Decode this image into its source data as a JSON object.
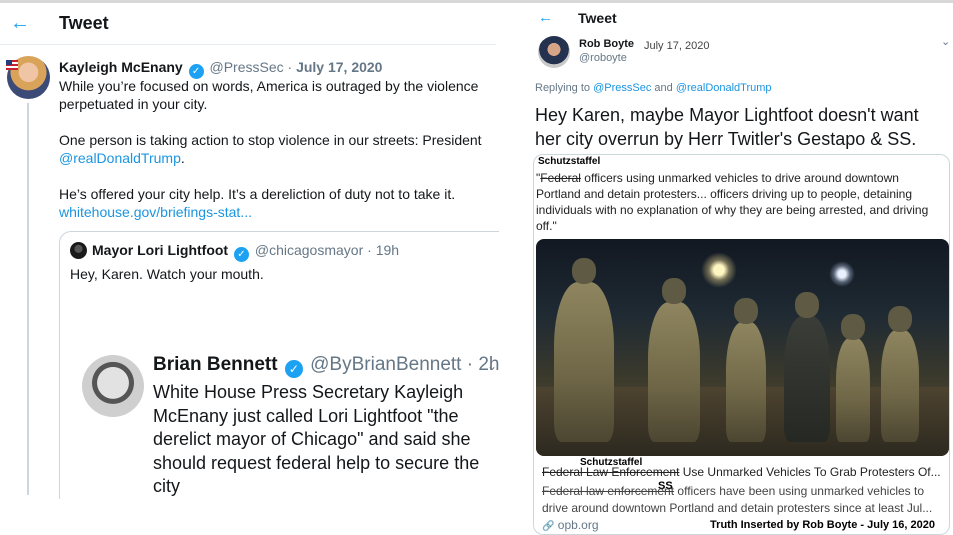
{
  "left": {
    "back_icon": "←",
    "title": "Tweet",
    "tweet": {
      "name": "Kayleigh McEnany",
      "verified_icon": "✓",
      "handle": "@PressSec",
      "separator": "·",
      "date": "July 17, 2020",
      "line1": "While you’re focused on words, America is outraged by the violence",
      "line2": "perpetuated in your city.",
      "line3": "One person is taking action to stop violence in our streets: President",
      "mention": "@realDonaldTrump",
      "mention_suffix": ".",
      "line4": "He’s offered your city help. It’s a dereliction of duty not to take it.",
      "link": "whitehouse.gov/briefings-stat..."
    },
    "quoted": {
      "name": "Mayor Lori Lightfoot",
      "handle": "@chicagosmayor",
      "separator": "·",
      "time": "19h",
      "text": "Hey, Karen. Watch your mouth."
    },
    "embedded": {
      "name": "Brian Bennett",
      "handle": "@ByBrianBennett",
      "separator": "·",
      "time": "2h",
      "chevron_icon": "⌄",
      "text": "White House Press Secretary Kayleigh McEnany just called Lori Lightfoot \"the derelict mayor of Chicago\" and said she should request federal help to secure the city"
    }
  },
  "right": {
    "back_icon": "←",
    "title": "Tweet",
    "name": "Rob Boyte",
    "date": "July 17, 2020",
    "handle": "@roboyte",
    "chevron_icon": "⌄",
    "reply_prefix": "Replying to ",
    "reply_to_1": "@PressSec",
    "reply_and": " and ",
    "reply_to_2": "@realDonaldTrump",
    "text": "Hey Karen, maybe Mayor Lightfoot doesn't want her city overrun by Herr Twitler's Gestapo & SS.",
    "card": {
      "overlay_top": "Schutzstaffel",
      "quote_open": "\"",
      "quote_strike": "Federal",
      "quote_rest": " officers using unmarked vehicles to drive around downtown Portland and detain protesters... officers driving up to people, detaining individuals with no explanation of why they are being arrested, and driving off.\"",
      "overlay_mid_1": "Schutzstaffel",
      "overlay_mid_2": "SS",
      "title_strike": "Federal Law Enforcement",
      "title_rest": " Use Unmarked Vehicles To Grab Protesters Of...",
      "desc_strike": "Federal law enforcement",
      "desc_rest": " officers have been using unmarked vehicles to drive around downtown Portland and detain protesters since at least Jul...",
      "link_icon": "🔗",
      "domain": "opb.org",
      "credit": "Truth Inserted by Rob Boyte - July 16, 2020"
    }
  }
}
